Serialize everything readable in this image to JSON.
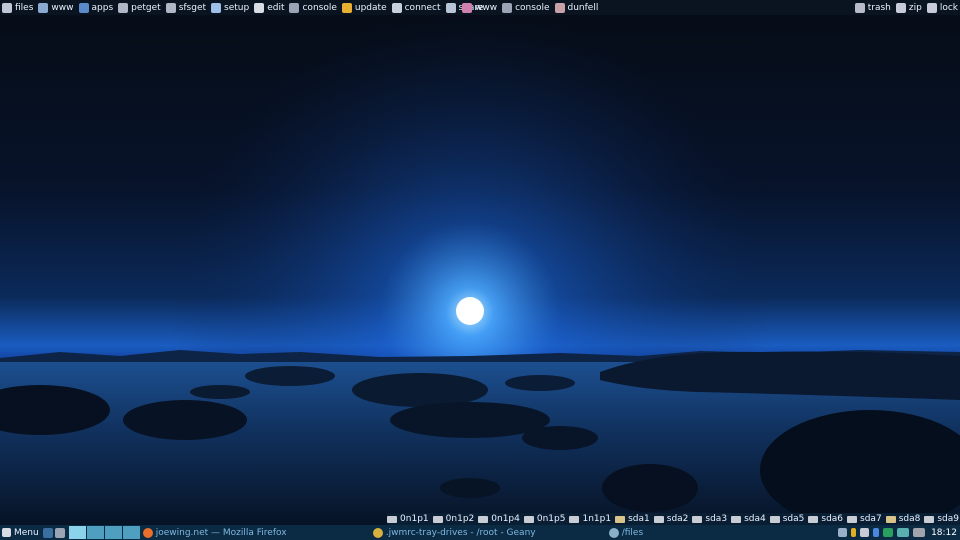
{
  "top_panel": {
    "left_items": [
      {
        "label": "files",
        "icon": "files-icon",
        "color": "#c0c8d8"
      },
      {
        "label": "www",
        "icon": "globe-icon",
        "color": "#8aa8d0"
      },
      {
        "label": "apps",
        "icon": "apps-icon",
        "color": "#5a8ac8"
      },
      {
        "label": "petget",
        "icon": "package-icon",
        "color": "#b0b8c8"
      },
      {
        "label": "sfsget",
        "icon": "download-icon",
        "color": "#b0b8c8"
      },
      {
        "label": "setup",
        "icon": "wand-icon",
        "color": "#9fc0e8"
      },
      {
        "label": "edit",
        "icon": "edit-icon",
        "color": "#d8dce4"
      },
      {
        "label": "console",
        "icon": "terminal-icon",
        "color": "#9aa4b4"
      },
      {
        "label": "update",
        "icon": "update-icon",
        "color": "#e8b030"
      },
      {
        "label": "connect",
        "icon": "network-icon",
        "color": "#c8d0e0"
      },
      {
        "label": "share",
        "icon": "share-icon",
        "color": "#b8c4d8"
      }
    ],
    "middle_items": [
      {
        "label": "www",
        "icon": "browser-icon",
        "color": "#d080b0"
      },
      {
        "label": "console",
        "icon": "terminal-icon",
        "color": "#9aa4b4"
      },
      {
        "label": "dunfell",
        "icon": "dunfell-icon",
        "color": "#c8a0a8"
      }
    ],
    "right_items": [
      {
        "label": "trash",
        "icon": "trash-icon",
        "color": "#b8bcc8"
      },
      {
        "label": "zip",
        "icon": "zip-icon",
        "color": "#c8ccd8"
      },
      {
        "label": "lock",
        "icon": "lock-icon",
        "color": "#c8ccd8"
      }
    ]
  },
  "drives": [
    {
      "label": "0n1p1",
      "icon": "drive-icon"
    },
    {
      "label": "0n1p2",
      "icon": "drive-icon"
    },
    {
      "label": "0n1p4",
      "icon": "drive-icon"
    },
    {
      "label": "0n1p5",
      "icon": "drive-icon"
    },
    {
      "label": "1n1p1",
      "icon": "drive-icon"
    },
    {
      "label": "sda1",
      "icon": "usb-drive-icon"
    },
    {
      "label": "sda2",
      "icon": "drive-icon"
    },
    {
      "label": "sda3",
      "icon": "drive-icon"
    },
    {
      "label": "sda4",
      "icon": "drive-icon"
    },
    {
      "label": "sda5",
      "icon": "drive-icon"
    },
    {
      "label": "sda6",
      "icon": "drive-icon"
    },
    {
      "label": "sda7",
      "icon": "drive-icon"
    },
    {
      "label": "sda8",
      "icon": "usb-drive-icon"
    },
    {
      "label": "sda9",
      "icon": "drive-icon"
    }
  ],
  "taskbar": {
    "menu_label": "Menu",
    "pager_desktops": 4,
    "pager_active_index": 0,
    "windows": [
      {
        "title": "joewing.net — Mozilla Firefox",
        "icon": "firefox-icon"
      },
      {
        "title": ".jwmrc-tray-drives - /root - Geany",
        "icon": "geany-icon"
      },
      {
        "title": "/files",
        "icon": "folder-icon"
      }
    ],
    "clock": "18:12"
  },
  "colors": {
    "panel_bg": "#0a1420",
    "taskbar_bg": "#0b2a44",
    "pager": "#4fa0c0",
    "window_title": "#7fb8e0",
    "moon": "#ffffff",
    "horizon_glow": "#1f6fd8"
  }
}
